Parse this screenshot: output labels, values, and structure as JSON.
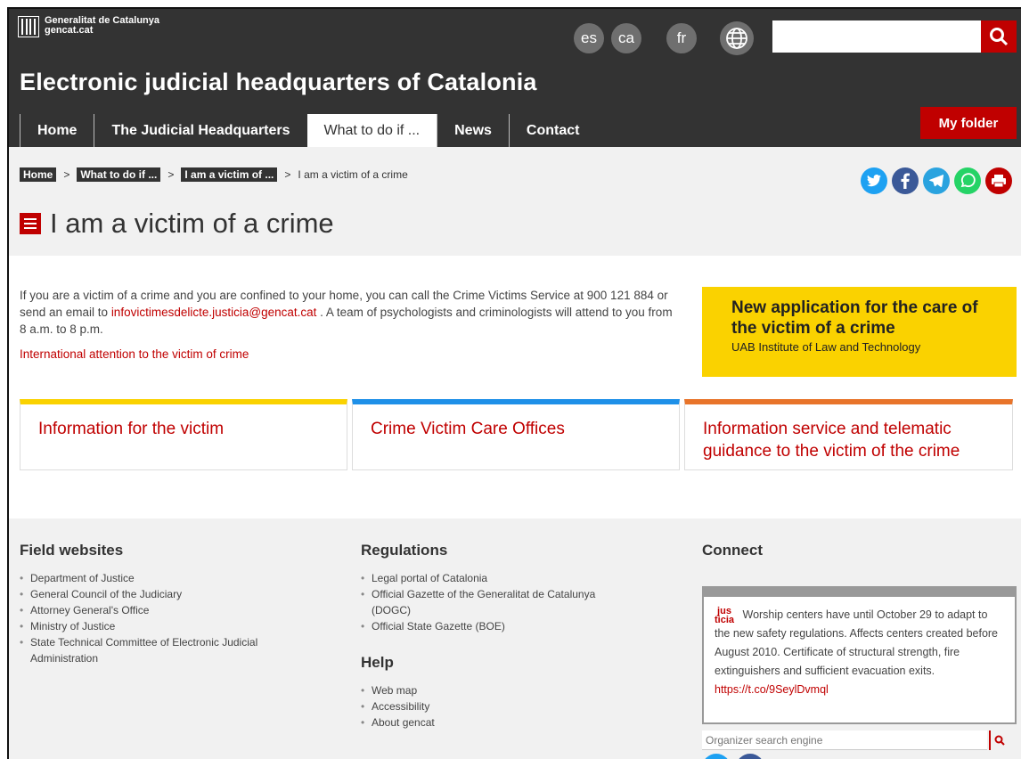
{
  "header": {
    "logo_line1": "Generalitat de Catalunya",
    "logo_line2": "gencat.cat",
    "languages": [
      "es",
      "ca",
      "fr"
    ],
    "search_placeholder": "",
    "site_title": "Electronic judicial headquarters of Catalonia",
    "nav": [
      "Home",
      "The Judicial Headquarters",
      "What to do if ...",
      "News",
      "Contact"
    ],
    "my_folder": "My folder"
  },
  "breadcrumb": {
    "items": [
      "Home",
      "What to do if ...",
      "I am a victim of ..."
    ],
    "current": "I am a victim of a crime",
    "separator": ">"
  },
  "page_title": "I am a victim of a crime",
  "intro": {
    "text_before": "If you are a victim of a crime and you are confined to your home, you can call the Crime Victims Service at 900 121 884 or send an email to ",
    "email": "infovictimesdelicte.justicia@gencat.cat",
    "text_after": " . A team of psychologists and criminologists will attend to you from 8 a.m. to 8 p.m.",
    "link": "International attention to the victim of crime"
  },
  "promo": {
    "title": "New application for the care of the victim of a crime",
    "subtitle": "UAB Institute of Law and Technology"
  },
  "cards": [
    {
      "label": "Information for the victim",
      "color": "#fad200"
    },
    {
      "label": "Crime Victim Care Offices",
      "color": "#1e90e8"
    },
    {
      "label": "Information service and telematic guidance to the victim of the crime",
      "color": "#e8742a"
    }
  ],
  "footer": {
    "field_websites": {
      "title": "Field websites",
      "items": [
        "Department of Justice",
        "General Council of the Judiciary",
        "Attorney General's Office",
        "Ministry of Justice",
        "State Technical Committee of Electronic Judicial Administration"
      ]
    },
    "regulations": {
      "title": "Regulations",
      "items": [
        "Legal portal of Catalonia",
        "Official Gazette of the Generalitat de Catalunya (DOGC)",
        "Official State Gazette (BOE)"
      ]
    },
    "help": {
      "title": "Help",
      "items": [
        "Web map",
        "Accessibility",
        "About gencat"
      ]
    },
    "connect": {
      "title": "Connect",
      "tweet_logo_top": "jus",
      "tweet_logo_bottom": "ticia",
      "tweet_text": "Worship centers have until October 29 to adapt to the new safety regulations. Affects centers created before August 2010. Certificate of structural strength, fire extinguishers and sufficient evacuation exits.",
      "tweet_link": "https://t.co/9SeylDvmql",
      "search_placeholder": "Organizer search engine"
    }
  },
  "colors": {
    "header_bg": "#333333",
    "accent_red": "#c00000",
    "promo_yellow": "#fad200"
  }
}
